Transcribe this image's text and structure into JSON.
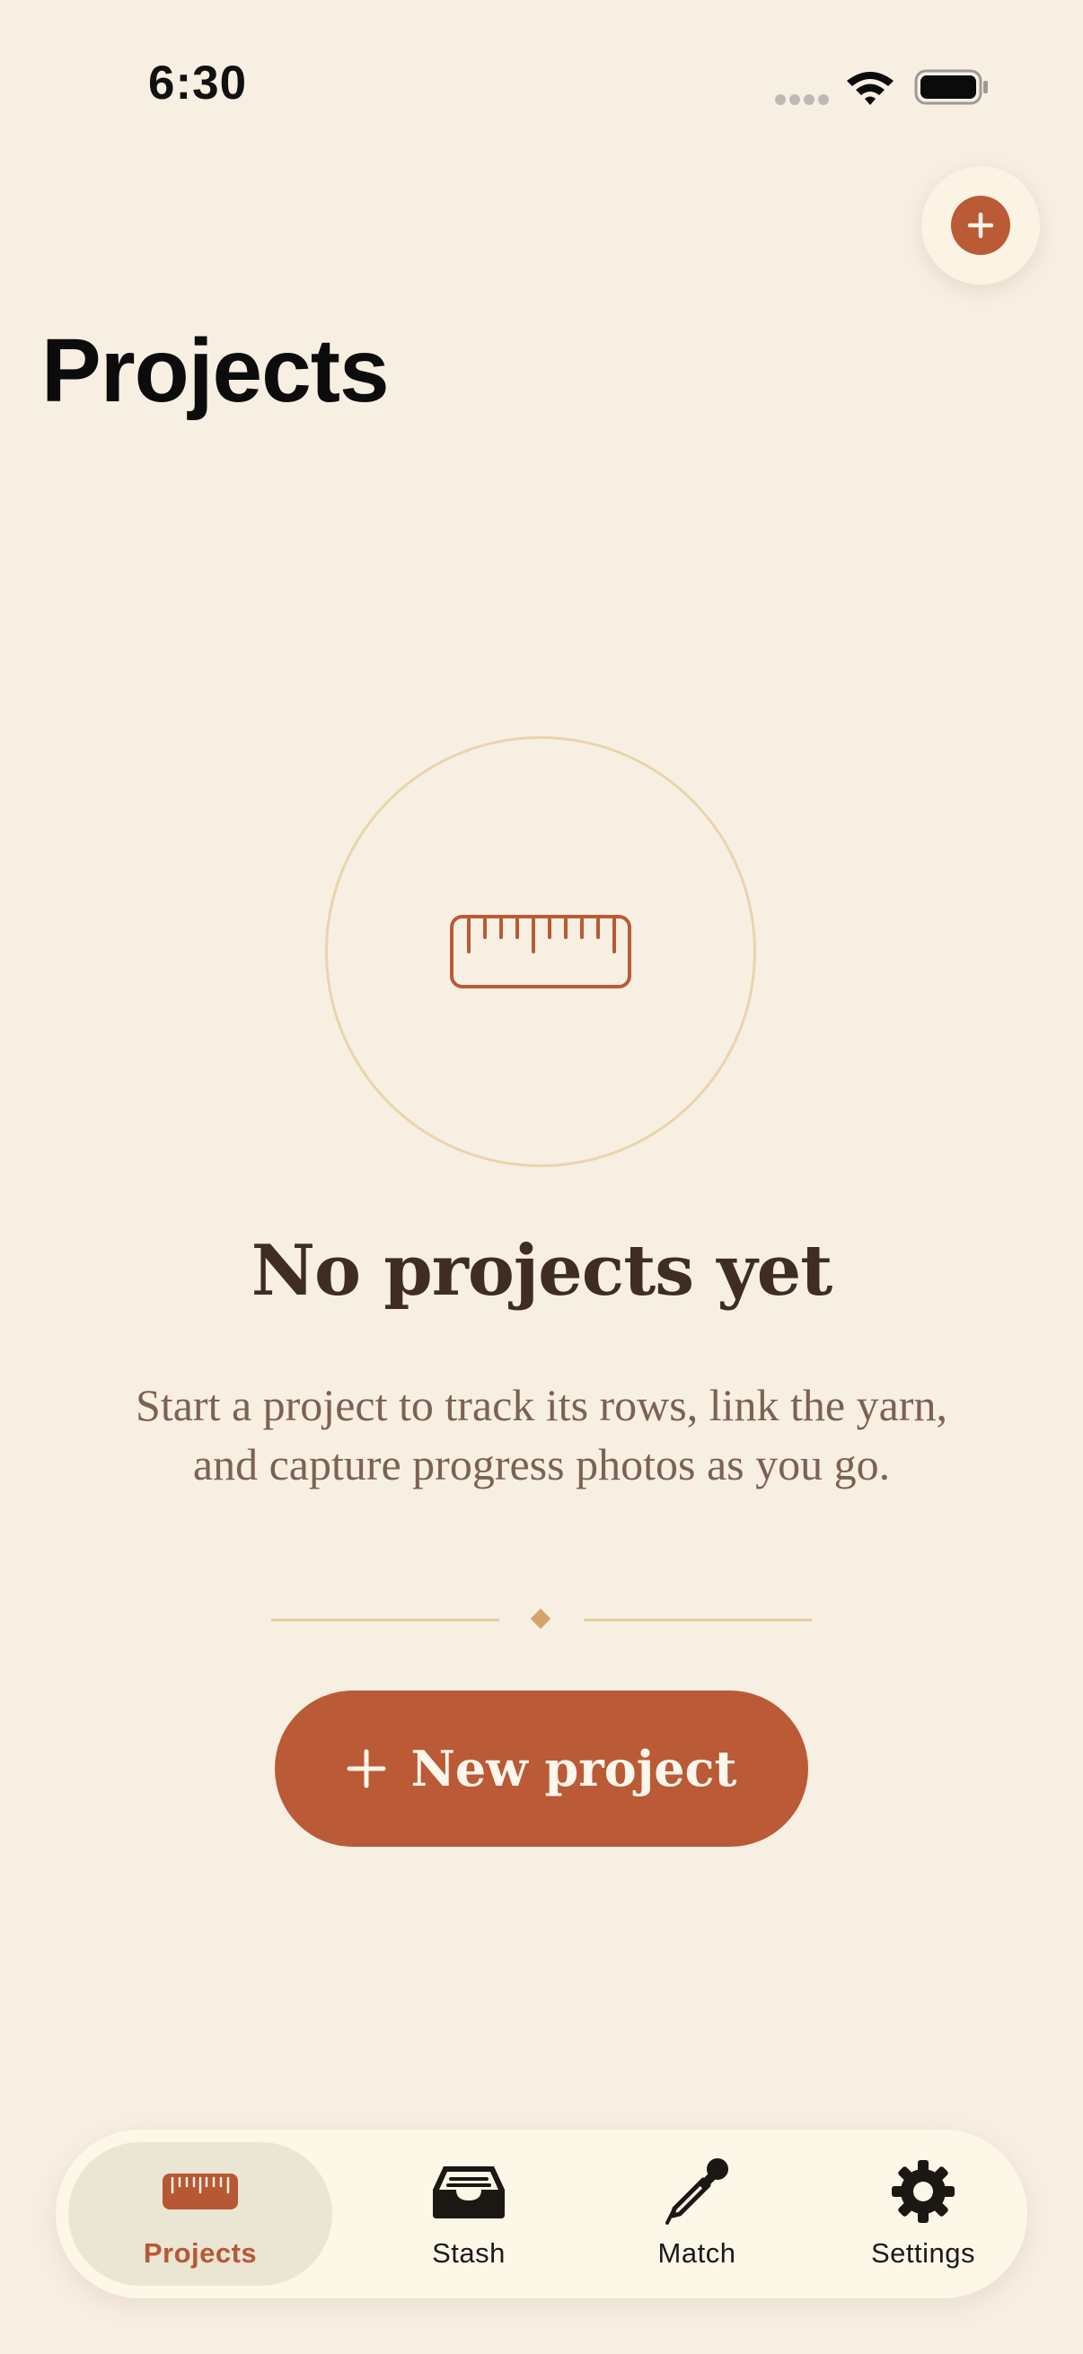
{
  "status_bar": {
    "time": "6:30"
  },
  "header": {
    "title": "Projects",
    "add_button_icon": "plus-icon"
  },
  "empty_state": {
    "icon": "ruler-icon",
    "title": "No projects yet",
    "description": "Start a project to track its rows, link the yarn, and capture progress photos as you go.",
    "button_label": "New project"
  },
  "tab_bar": {
    "items": [
      {
        "label": "Projects",
        "icon": "ruler-icon",
        "active": true
      },
      {
        "label": "Stash",
        "icon": "tray-icon",
        "active": false
      },
      {
        "label": "Match",
        "icon": "eyedropper-icon",
        "active": false
      },
      {
        "label": "Settings",
        "icon": "gear-icon",
        "active": false
      }
    ]
  },
  "colors": {
    "background": "#f8efe3",
    "accent": "#bb5a36",
    "title_text": "#3f2d22",
    "body_text": "#7c6252",
    "circle_stroke": "#ead4ac"
  }
}
